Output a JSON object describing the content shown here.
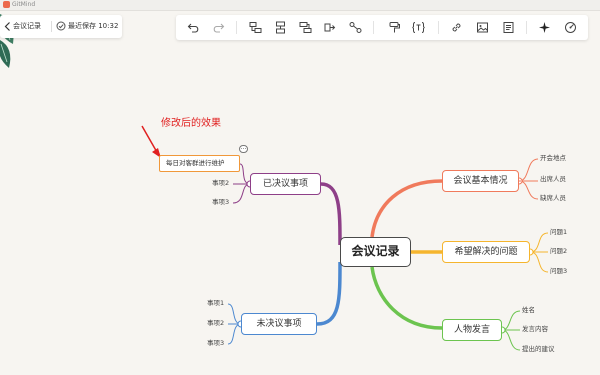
{
  "app": {
    "name": "GitMind"
  },
  "doc": {
    "title": "会议记录",
    "save_status": "最近保存 10:32"
  },
  "toolbar": {
    "buttons": [
      "undo-icon",
      "redo-icon",
      "child-node-icon",
      "sibling-node-icon",
      "parent-node-icon",
      "summary-icon",
      "relation-icon",
      "format-painter-icon",
      "formula-icon",
      "link-icon",
      "image-icon",
      "note-icon",
      "style-icon",
      "theme-icon"
    ]
  },
  "annotation": {
    "text": "修改后的效果",
    "color": "#e02020"
  },
  "mindmap": {
    "root": "会议记录",
    "branches": [
      {
        "label": "会议基本情况",
        "color": "#f07a5c",
        "children": [
          "开会地点",
          "出席人员",
          "缺席人员"
        ]
      },
      {
        "label": "希望解决的问题",
        "color": "#f5b52e",
        "children": [
          "问题1",
          "问题2",
          "问题3"
        ]
      },
      {
        "label": "人物发言",
        "color": "#6cc44f",
        "children": [
          "姓名",
          "发言内容",
          "提出的建议"
        ]
      },
      {
        "label": "已决议事项",
        "color": "#8e3f88",
        "children": [
          "每日对客群进行维护",
          "事项2",
          "事项3"
        ]
      },
      {
        "label": "未决议事项",
        "color": "#4c88d0",
        "children": [
          "事项1",
          "事项2",
          "事项3"
        ]
      }
    ],
    "selected_node": "每日对客群进行维护"
  }
}
